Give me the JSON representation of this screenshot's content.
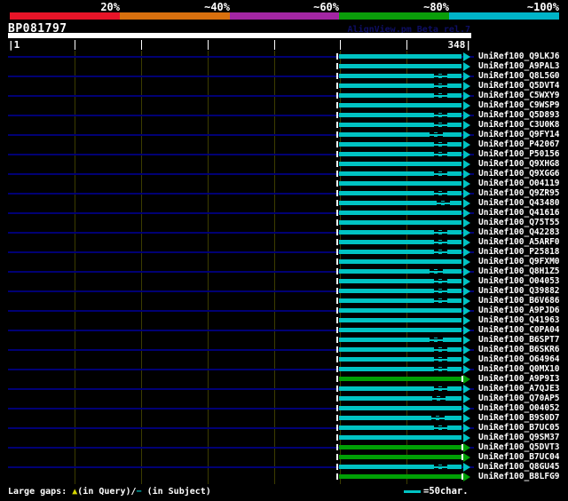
{
  "header": {
    "query_name": "BP081797",
    "version_text": "AlignView.pm Beta rel.7"
  },
  "identity_scale": {
    "labels": [
      "20%",
      "~40%",
      "~60%",
      "~80%",
      "~100%"
    ],
    "colors": [
      "#e81428",
      "#d8700e",
      "#a326a3",
      "#0a9e0a",
      "#00b4c8"
    ]
  },
  "ruler": {
    "left_label": "|1",
    "right_label": "348|",
    "tick_residues": [
      50,
      100,
      150,
      200,
      250,
      300
    ]
  },
  "legend": {
    "prefix": "Large gaps: ",
    "query_gap_symbol": "▲",
    "query_gap_text": "(in Query)/",
    "subject_gap_symbol": "−",
    "subject_gap_text": " (in Subject)",
    "scale_text": "=50char."
  },
  "colors": {
    "cyan": "#00c3c3",
    "green": "#00a005",
    "leader_navy": "#000074",
    "grid_olive": "#3c3c00",
    "gap_query_yellow": "#d6d600",
    "version_navy": "#0e0e64",
    "white": "#ffffff"
  },
  "chart_data": {
    "type": "bar",
    "orientation": "horizontal",
    "title": "BP081797",
    "query_range": [
      1,
      348
    ],
    "ruler_interval_chars": 50,
    "note": "bars are alignment spans of database hits on the query; color bin = approx identity; arrowhead = plus-strand direction; thin dash = large gap in subject",
    "hits": [
      {
        "label": "UniRef100_Q9LKJ6",
        "bin": "~100%",
        "color": "cyan",
        "start": 250,
        "end": 348,
        "subject_gap_at": null
      },
      {
        "label": "UniRef100_A9PAL3",
        "bin": "~100%",
        "color": "cyan",
        "start": 250,
        "end": 348,
        "subject_gap_at": null
      },
      {
        "label": "UniRef100_Q8L5G0",
        "bin": "~100%",
        "color": "cyan",
        "start": 250,
        "end": 348,
        "subject_gap_at": 325
      },
      {
        "label": "UniRef100_Q5DVT4",
        "bin": "~100%",
        "color": "cyan",
        "start": 250,
        "end": 348,
        "subject_gap_at": 325
      },
      {
        "label": "UniRef100_C5WXY9",
        "bin": "~100%",
        "color": "cyan",
        "start": 250,
        "end": 348,
        "subject_gap_at": 325
      },
      {
        "label": "UniRef100_C9WSP9",
        "bin": "~100%",
        "color": "cyan",
        "start": 250,
        "end": 348,
        "subject_gap_at": null
      },
      {
        "label": "UniRef100_Q5D893",
        "bin": "~100%",
        "color": "cyan",
        "start": 250,
        "end": 348,
        "subject_gap_at": 325
      },
      {
        "label": "UniRef100_C3U0K8",
        "bin": "~100%",
        "color": "cyan",
        "start": 250,
        "end": 348,
        "subject_gap_at": 325
      },
      {
        "label": "UniRef100_Q9FY14",
        "bin": "~100%",
        "color": "cyan",
        "start": 250,
        "end": 348,
        "subject_gap_at": 322
      },
      {
        "label": "UniRef100_P42067",
        "bin": "~100%",
        "color": "cyan",
        "start": 250,
        "end": 348,
        "subject_gap_at": 325
      },
      {
        "label": "UniRef100_P50156",
        "bin": "~100%",
        "color": "cyan",
        "start": 250,
        "end": 348,
        "subject_gap_at": 325
      },
      {
        "label": "UniRef100_Q9XHG8",
        "bin": "~100%",
        "color": "cyan",
        "start": 250,
        "end": 348,
        "subject_gap_at": null
      },
      {
        "label": "UniRef100_Q9XGG6",
        "bin": "~100%",
        "color": "cyan",
        "start": 250,
        "end": 348,
        "subject_gap_at": 325
      },
      {
        "label": "UniRef100_O04119",
        "bin": "~100%",
        "color": "cyan",
        "start": 250,
        "end": 348,
        "subject_gap_at": null
      },
      {
        "label": "UniRef100_Q9ZR95",
        "bin": "~100%",
        "color": "cyan",
        "start": 250,
        "end": 348,
        "subject_gap_at": 325
      },
      {
        "label": "UniRef100_Q43480",
        "bin": "~100%",
        "color": "cyan",
        "start": 250,
        "end": 348,
        "subject_gap_at": 327
      },
      {
        "label": "UniRef100_Q41616",
        "bin": "~100%",
        "color": "cyan",
        "start": 250,
        "end": 348,
        "subject_gap_at": null
      },
      {
        "label": "UniRef100_Q75T55",
        "bin": "~100%",
        "color": "cyan",
        "start": 250,
        "end": 348,
        "subject_gap_at": null
      },
      {
        "label": "UniRef100_Q42283",
        "bin": "~100%",
        "color": "cyan",
        "start": 250,
        "end": 348,
        "subject_gap_at": 325
      },
      {
        "label": "UniRef100_A5ARF0",
        "bin": "~100%",
        "color": "cyan",
        "start": 250,
        "end": 348,
        "subject_gap_at": 325
      },
      {
        "label": "UniRef100_P25818",
        "bin": "~100%",
        "color": "cyan",
        "start": 250,
        "end": 348,
        "subject_gap_at": 325
      },
      {
        "label": "UniRef100_Q9FXM0",
        "bin": "~100%",
        "color": "cyan",
        "start": 250,
        "end": 348,
        "subject_gap_at": null
      },
      {
        "label": "UniRef100_Q8H1Z5",
        "bin": "~100%",
        "color": "cyan",
        "start": 250,
        "end": 348,
        "subject_gap_at": 322
      },
      {
        "label": "UniRef100_O04053",
        "bin": "~100%",
        "color": "cyan",
        "start": 250,
        "end": 348,
        "subject_gap_at": 325
      },
      {
        "label": "UniRef100_Q39882",
        "bin": "~100%",
        "color": "cyan",
        "start": 250,
        "end": 348,
        "subject_gap_at": 325
      },
      {
        "label": "UniRef100_B6V686",
        "bin": "~100%",
        "color": "cyan",
        "start": 250,
        "end": 348,
        "subject_gap_at": 325
      },
      {
        "label": "UniRef100_A9PJD6",
        "bin": "~100%",
        "color": "cyan",
        "start": 250,
        "end": 348,
        "subject_gap_at": null
      },
      {
        "label": "UniRef100_Q41963",
        "bin": "~100%",
        "color": "cyan",
        "start": 250,
        "end": 348,
        "subject_gap_at": null
      },
      {
        "label": "UniRef100_C0PA04",
        "bin": "~100%",
        "color": "cyan",
        "start": 250,
        "end": 348,
        "subject_gap_at": null
      },
      {
        "label": "UniRef100_B6SPT7",
        "bin": "~100%",
        "color": "cyan",
        "start": 250,
        "end": 348,
        "subject_gap_at": 322
      },
      {
        "label": "UniRef100_B6SKR6",
        "bin": "~100%",
        "color": "cyan",
        "start": 250,
        "end": 348,
        "subject_gap_at": 325
      },
      {
        "label": "UniRef100_O64964",
        "bin": "~100%",
        "color": "cyan",
        "start": 250,
        "end": 348,
        "subject_gap_at": 325
      },
      {
        "label": "UniRef100_Q0MX10",
        "bin": "~100%",
        "color": "cyan",
        "start": 250,
        "end": 348,
        "subject_gap_at": 325
      },
      {
        "label": "UniRef100_A9P9I3",
        "bin": "~80%",
        "color": "green",
        "start": 250,
        "end": 348,
        "subject_gap_at": null
      },
      {
        "label": "UniRef100_A7QJE3",
        "bin": "~100%",
        "color": "cyan",
        "start": 250,
        "end": 348,
        "subject_gap_at": 325
      },
      {
        "label": "UniRef100_Q70AP5",
        "bin": "~100%",
        "color": "cyan",
        "start": 250,
        "end": 348,
        "subject_gap_at": 324
      },
      {
        "label": "UniRef100_O04052",
        "bin": "~100%",
        "color": "cyan",
        "start": 250,
        "end": 348,
        "subject_gap_at": null
      },
      {
        "label": "UniRef100_B9S0D7",
        "bin": "~100%",
        "color": "cyan",
        "start": 250,
        "end": 348,
        "subject_gap_at": 323
      },
      {
        "label": "UniRef100_B7UC05",
        "bin": "~100%",
        "color": "cyan",
        "start": 250,
        "end": 348,
        "subject_gap_at": 325
      },
      {
        "label": "UniRef100_Q9SM37",
        "bin": "~100%",
        "color": "cyan",
        "start": 250,
        "end": 348,
        "subject_gap_at": null
      },
      {
        "label": "UniRef100_Q5DVT3",
        "bin": "~80%",
        "color": "green",
        "start": 250,
        "end": 348,
        "subject_gap_at": null
      },
      {
        "label": "UniRef100_B7UC04",
        "bin": "~80%",
        "color": "green",
        "start": 250,
        "end": 348,
        "subject_gap_at": null
      },
      {
        "label": "UniRef100_Q8GU45",
        "bin": "~100%",
        "color": "cyan",
        "start": 250,
        "end": 348,
        "subject_gap_at": 325
      },
      {
        "label": "UniRef100_B8LFG9",
        "bin": "~80%",
        "color": "green",
        "start": 250,
        "end": 348,
        "subject_gap_at": null
      }
    ]
  }
}
